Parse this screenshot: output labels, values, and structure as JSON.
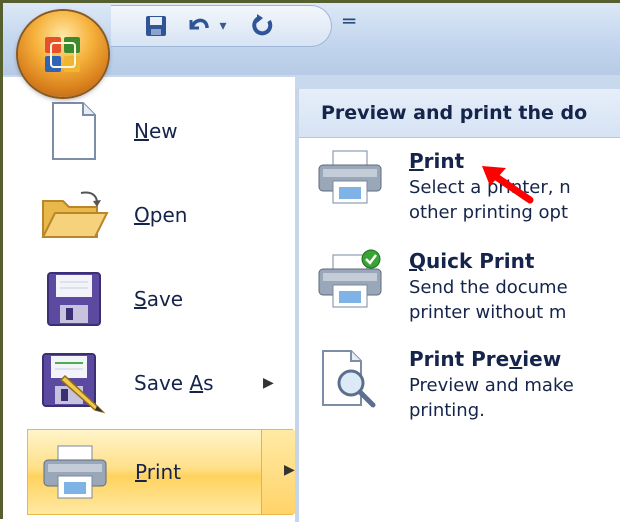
{
  "quick_access": {
    "office_button_icon": "office-logo-icon",
    "save_icon": "save-icon",
    "undo_icon": "undo-icon",
    "undo_dropdown": "▾",
    "redo_icon": "redo-icon",
    "customize_glyph": "═"
  },
  "left_menu": {
    "items": [
      {
        "pre": "",
        "key": "N",
        "post": "ew",
        "icon": "new-document-icon"
      },
      {
        "pre": "",
        "key": "O",
        "post": "pen",
        "icon": "open-folder-icon"
      },
      {
        "pre": "",
        "key": "S",
        "post": "ave",
        "icon": "save-disk-icon"
      },
      {
        "pre": "Save ",
        "key": "A",
        "post": "s",
        "icon": "save-as-icon",
        "has_submenu": true
      },
      {
        "pre": "",
        "key": "P",
        "post": "rint",
        "icon": "printer-icon",
        "has_submenu": true,
        "highlighted": true
      }
    ],
    "submenu_arrow": "▶"
  },
  "right_panel": {
    "header": "Preview and print the do",
    "options": [
      {
        "title_key": "P",
        "title_rest": "rint",
        "desc": "Select a printer, n\nother printing opt",
        "icon": "printer-icon"
      },
      {
        "title_key": "Q",
        "title_rest": "uick Print",
        "desc": "Send the docume\nprinter without m",
        "icon": "quick-print-icon"
      },
      {
        "title_pre": "Print Pre",
        "title_key": "v",
        "title_rest": "iew",
        "desc": "Preview and make\nprinting.",
        "icon": "print-preview-icon"
      }
    ]
  },
  "colors": {
    "frame_border": "#56602f",
    "menu_text": "#15244a",
    "highlight": "#ffd25e",
    "annotation_arrow": "#ff0000"
  }
}
